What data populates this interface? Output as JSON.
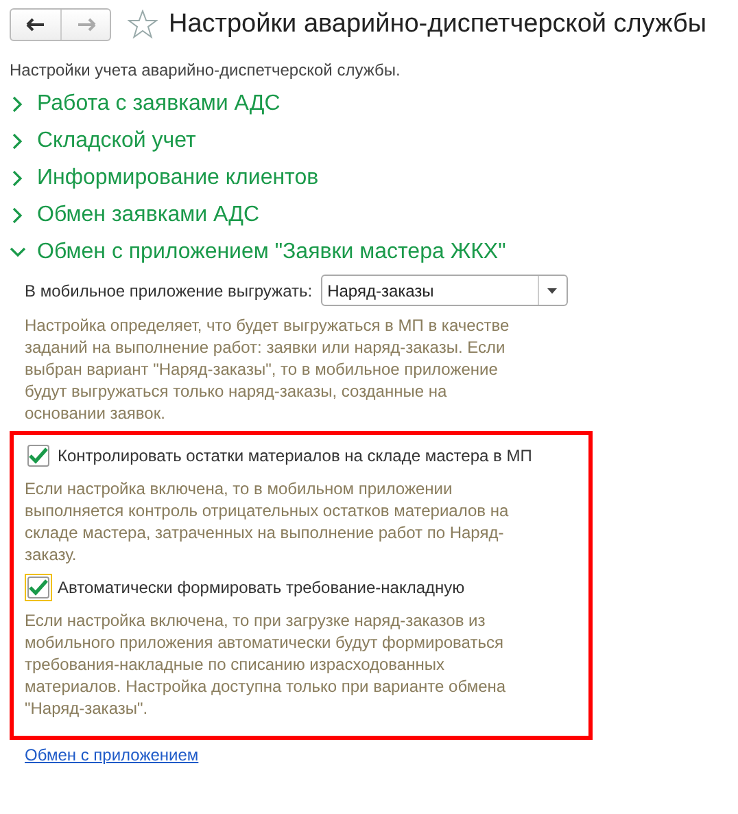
{
  "window": {
    "title": "Настройки аварийно-диспетчерской службы",
    "favorite": false
  },
  "description": "Настройки учета аварийно-диспетчерской службы.",
  "groups": [
    {
      "label": "Работа с заявками АДС",
      "expanded": false
    },
    {
      "label": "Складской учет",
      "expanded": false
    },
    {
      "label": "Информирование клиентов",
      "expanded": false
    },
    {
      "label": "Обмен заявками АДС",
      "expanded": false
    },
    {
      "label": "Обмен с приложением \"Заявки мастера ЖКХ\"",
      "expanded": true
    }
  ],
  "export_field": {
    "label": "В мобильное приложение выгружать:",
    "value": "Наряд-заказы",
    "hint": "Настройка определяет, что будет выгружаться в МП в качестве заданий на выполнение работ: заявки или наряд-заказы. Если выбран вариант \"Наряд-заказы\", то в мобильное приложение будут выгружаться только наряд-заказы, созданные на основании заявок."
  },
  "highlighted_settings": [
    {
      "label": "Контролировать остатки материалов на складе мастера в МП",
      "checked": true,
      "focused": false,
      "hint": "Если настройка включена, то в мобильном приложении выполняется контроль отрицательных остатков материалов на складе мастера, затраченных на выполнение работ по Наряд-заказу."
    },
    {
      "label": "Автоматически формировать требование-накладную",
      "checked": true,
      "focused": true,
      "hint": "Если настройка включена, то при загрузке наряд-заказов из мобильного приложения автоматически будут формироваться требования-накладные по списанию израсходованных материалов. Настройка доступна только при варианте обмена \"Наряд-заказы\"."
    }
  ],
  "link": "Обмен с приложением"
}
